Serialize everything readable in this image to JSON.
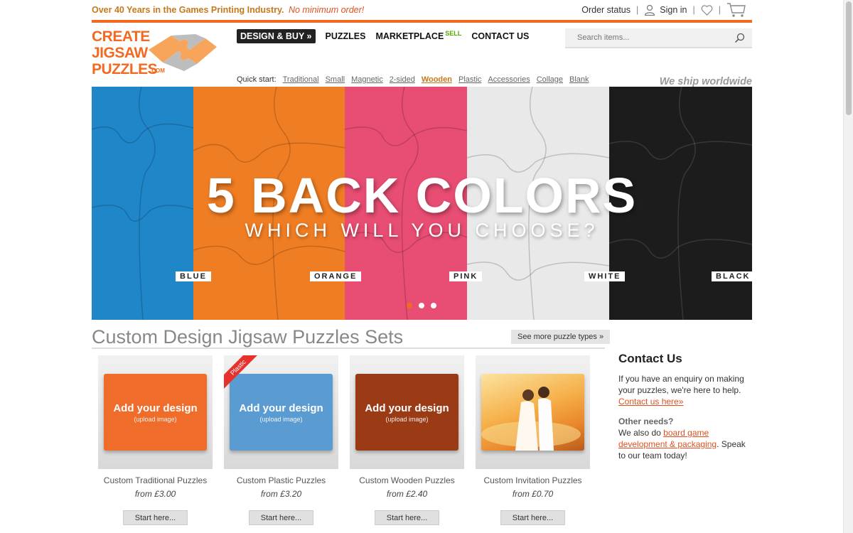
{
  "topbar": {
    "tagline": "Over 40 Years in the Games Printing Industry.",
    "no_minimum": "No minimum order!",
    "order_status": "Order status",
    "sign_in": "Sign in",
    "sep": "|"
  },
  "logo": {
    "line1": "CREATE",
    "line2": "JIGSAW",
    "line3": "PUZZLES",
    "com": ".COM"
  },
  "nav": {
    "design_buy": "DESIGN & BUY »",
    "puzzles": "PUZZLES",
    "marketplace": "MARKETPLACE",
    "sell": "SELL",
    "contact": "CONTACT US"
  },
  "search": {
    "placeholder": "Search items..."
  },
  "quick_start": {
    "label": "Quick start:",
    "items": [
      "Traditional",
      "Small",
      "Magnetic",
      "2-sided",
      "Wooden",
      "Plastic",
      "Accessories",
      "Collage",
      "Blank"
    ],
    "active": "Wooden"
  },
  "ship": "We ship worldwide",
  "banner": {
    "title": "5 BACK COLORS",
    "subtitle": "WHICH WILL YOU CHOOSE?",
    "colors": [
      {
        "label": "BLUE",
        "hex": "#1f86c8"
      },
      {
        "label": "ORANGE",
        "hex": "#ef7d23"
      },
      {
        "label": "PINK",
        "hex": "#e84d73"
      },
      {
        "label": "WHITE",
        "hex": "#e9e9e9"
      },
      {
        "label": "BLACK",
        "hex": "#1c1c1c"
      }
    ],
    "slides": 3,
    "active_slide": 1
  },
  "section": {
    "title": "Custom Design Jigsaw Puzzles Sets",
    "see_more": "See more puzzle types »"
  },
  "products": [
    {
      "name": "Custom Traditional Puzzles",
      "price": "from £3.00",
      "cta": "Start here...",
      "thumb_line1": "Add your design",
      "thumb_line2": "(upload image)",
      "color": "#ef6c2b"
    },
    {
      "name": "Custom Plastic Puzzles",
      "price": "from £3.20",
      "cta": "Start here...",
      "thumb_line1": "Add your design",
      "thumb_line2": "(upload image)",
      "color": "#5a9bd1",
      "ribbon": "Plastic"
    },
    {
      "name": "Custom Wooden Puzzles",
      "price": "from £2.40",
      "cta": "Start here...",
      "thumb_line1": "Add your design",
      "thumb_line2": "(upload image)",
      "color": "#9a3b16"
    },
    {
      "name": "Custom Invitation Puzzles",
      "price": "from £0.70",
      "cta": "Start here..."
    }
  ],
  "sidebar": {
    "title": "Contact Us",
    "text1": "If you have an enquiry on making your puzzles, we're here to help.",
    "link1": "Contact us here»",
    "other_title": "Other needs?",
    "text2": "We also do",
    "link2": "board game development & packaging",
    "text3": ". Speak to our team today!"
  }
}
